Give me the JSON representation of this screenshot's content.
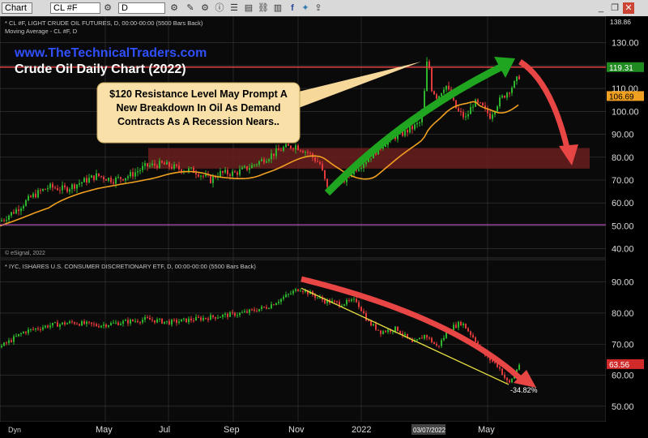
{
  "toolbar": {
    "app_label": "Chart",
    "symbol": "CL #F",
    "interval": "D",
    "icons": [
      "pencil-icon",
      "settings-icon",
      "info-icon",
      "rows-icon",
      "chart-icon",
      "link-icon",
      "facebook-icon",
      "twitter-icon",
      "share-icon"
    ],
    "window_controls": [
      "minimize-icon",
      "restore-icon",
      "close-icon"
    ]
  },
  "colors": {
    "background": "#000000",
    "grid": "#3a3a3a",
    "up_candle": "#2db52d",
    "down_candle": "#e03a3a",
    "moving_average": "#f0a020",
    "resistance_line": "#e04040",
    "support_line": "#c050c0",
    "green_arrow": "#1fa51f",
    "red_arrow": "#e84545",
    "watermark": "#3050ff"
  },
  "chart_data": [
    {
      "type": "candlestick",
      "header": "* CL #F, LIGHT CRUDE OIL FUTURES, D, 00:00-00:00 (5500 Bars Back)",
      "subheader": "Moving Average - CL #F, D",
      "watermark": "www.TheTechnicalTraders.com",
      "title": "Crude Oil Daily Chart (2022)",
      "copyright": "© eSignal, 2022",
      "ylim": [
        36,
        138
      ],
      "yticks": [
        40,
        50,
        60,
        70,
        80,
        90,
        100,
        110,
        120,
        130
      ],
      "ytick_labels": [
        "40.00",
        "50.00",
        "60.00",
        "70.00",
        "80.00",
        "90.00",
        "100.00",
        "110.00",
        "120.00",
        "130.00"
      ],
      "top_axis_label": "138.86",
      "last_price": 119.31,
      "last_price_label": "119.31",
      "ma_value": 106.69,
      "ma_value_label": "106.69",
      "resistance_level": 119.3,
      "support_level": 50.5,
      "zone": [
        75,
        84
      ],
      "callout": "$120 Resistance Level May Prompt A New Breakdown In Oil As Demand Contracts As A Recession Nears..",
      "price_path": [
        [
          0,
          52
        ],
        [
          20,
          57
        ],
        [
          40,
          63
        ],
        [
          60,
          67
        ],
        [
          80,
          66
        ],
        [
          100,
          69
        ],
        [
          120,
          72
        ],
        [
          140,
          70
        ],
        [
          160,
          72
        ],
        [
          180,
          76
        ],
        [
          200,
          77
        ],
        [
          220,
          75
        ],
        [
          240,
          74
        ],
        [
          260,
          70
        ],
        [
          270,
          73
        ],
        [
          290,
          73
        ],
        [
          310,
          76
        ],
        [
          330,
          80
        ],
        [
          350,
          84
        ],
        [
          365,
          85
        ],
        [
          380,
          82
        ],
        [
          395,
          77
        ],
        [
          405,
          65
        ],
        [
          415,
          69
        ],
        [
          425,
          70
        ],
        [
          435,
          74
        ],
        [
          450,
          78
        ],
        [
          465,
          83
        ],
        [
          480,
          88
        ],
        [
          495,
          90
        ],
        [
          510,
          93
        ],
        [
          518,
          95
        ],
        [
          522,
          100
        ],
        [
          528,
          125
        ],
        [
          533,
          110
        ],
        [
          540,
          106
        ],
        [
          550,
          112
        ],
        [
          558,
          105
        ],
        [
          565,
          100
        ],
        [
          575,
          97
        ],
        [
          585,
          104
        ],
        [
          595,
          102
        ],
        [
          605,
          98
        ],
        [
          615,
          104
        ],
        [
          625,
          108
        ],
        [
          635,
          112
        ],
        [
          642,
          116
        ]
      ]
    },
    {
      "type": "candlestick",
      "header": "* IYC, ISHARES U.S. CONSUMER DISCRETIONARY ETF, D, 00:00-00:00 (5500 Bars Back)",
      "ylim": [
        45,
        92
      ],
      "yticks": [
        50,
        60,
        70,
        80,
        90
      ],
      "ytick_labels": [
        "50.00",
        "60.00",
        "70.00",
        "80.00",
        "90.00"
      ],
      "last_price": 63.56,
      "last_price_label": "63.56",
      "change_label": "-34.82%",
      "price_path": [
        [
          0,
          69
        ],
        [
          30,
          74
        ],
        [
          60,
          76
        ],
        [
          90,
          77
        ],
        [
          120,
          76
        ],
        [
          150,
          77
        ],
        [
          180,
          78
        ],
        [
          210,
          77
        ],
        [
          240,
          78
        ],
        [
          270,
          79
        ],
        [
          300,
          80
        ],
        [
          330,
          82
        ],
        [
          350,
          85
        ],
        [
          370,
          88
        ],
        [
          385,
          86
        ],
        [
          400,
          84
        ],
        [
          420,
          83
        ],
        [
          440,
          84
        ],
        [
          455,
          77
        ],
        [
          470,
          74
        ],
        [
          490,
          75
        ],
        [
          510,
          70
        ],
        [
          525,
          73
        ],
        [
          540,
          69
        ],
        [
          555,
          75
        ],
        [
          570,
          77
        ],
        [
          585,
          72
        ],
        [
          600,
          66
        ],
        [
          615,
          63
        ],
        [
          628,
          57
        ],
        [
          642,
          64
        ]
      ]
    }
  ],
  "x_axis": {
    "labels": [
      "May",
      "Jul",
      "Sep",
      "Nov",
      "2022",
      "May"
    ],
    "highlight_label": "03/07/2022",
    "corner_label": "Dyn"
  }
}
